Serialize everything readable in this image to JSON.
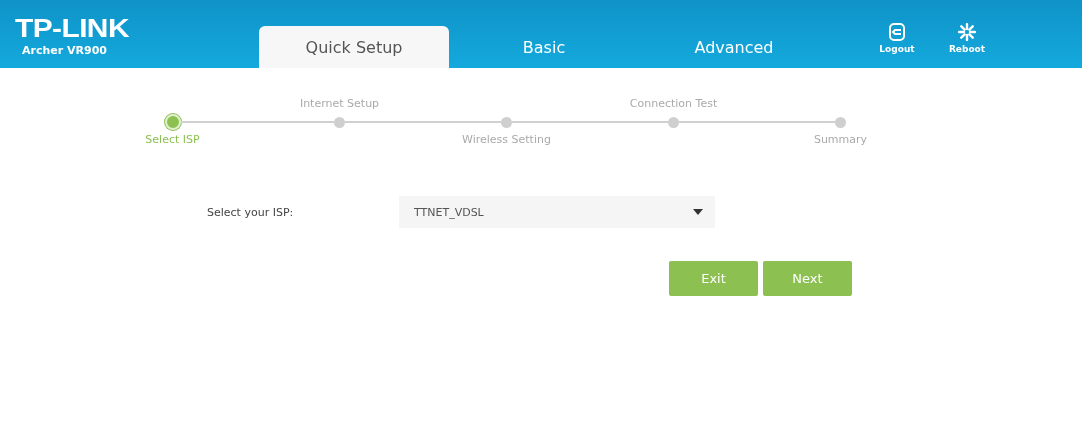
{
  "brand": {
    "logo": "TP-LINK",
    "model": "Archer VR900"
  },
  "tabs": [
    {
      "label": "Quick Setup",
      "selected": true
    },
    {
      "label": "Basic",
      "selected": false
    },
    {
      "label": "Advanced",
      "selected": false
    }
  ],
  "actions": [
    {
      "kind": "logout",
      "label": "Logout"
    },
    {
      "kind": "reboot",
      "label": "Reboot"
    }
  ],
  "steps": [
    {
      "label": "Select ISP",
      "selected": true
    },
    {
      "label": "Internet Setup",
      "selected": false
    },
    {
      "label": "Wireless Setting",
      "selected": false
    },
    {
      "label": "Connection Test",
      "selected": false
    },
    {
      "label": "Summary",
      "selected": false
    }
  ],
  "form": {
    "label": "Select your ISP:",
    "value": "TTNET_VDSL"
  },
  "buttons": [
    "Exit",
    "Next"
  ]
}
